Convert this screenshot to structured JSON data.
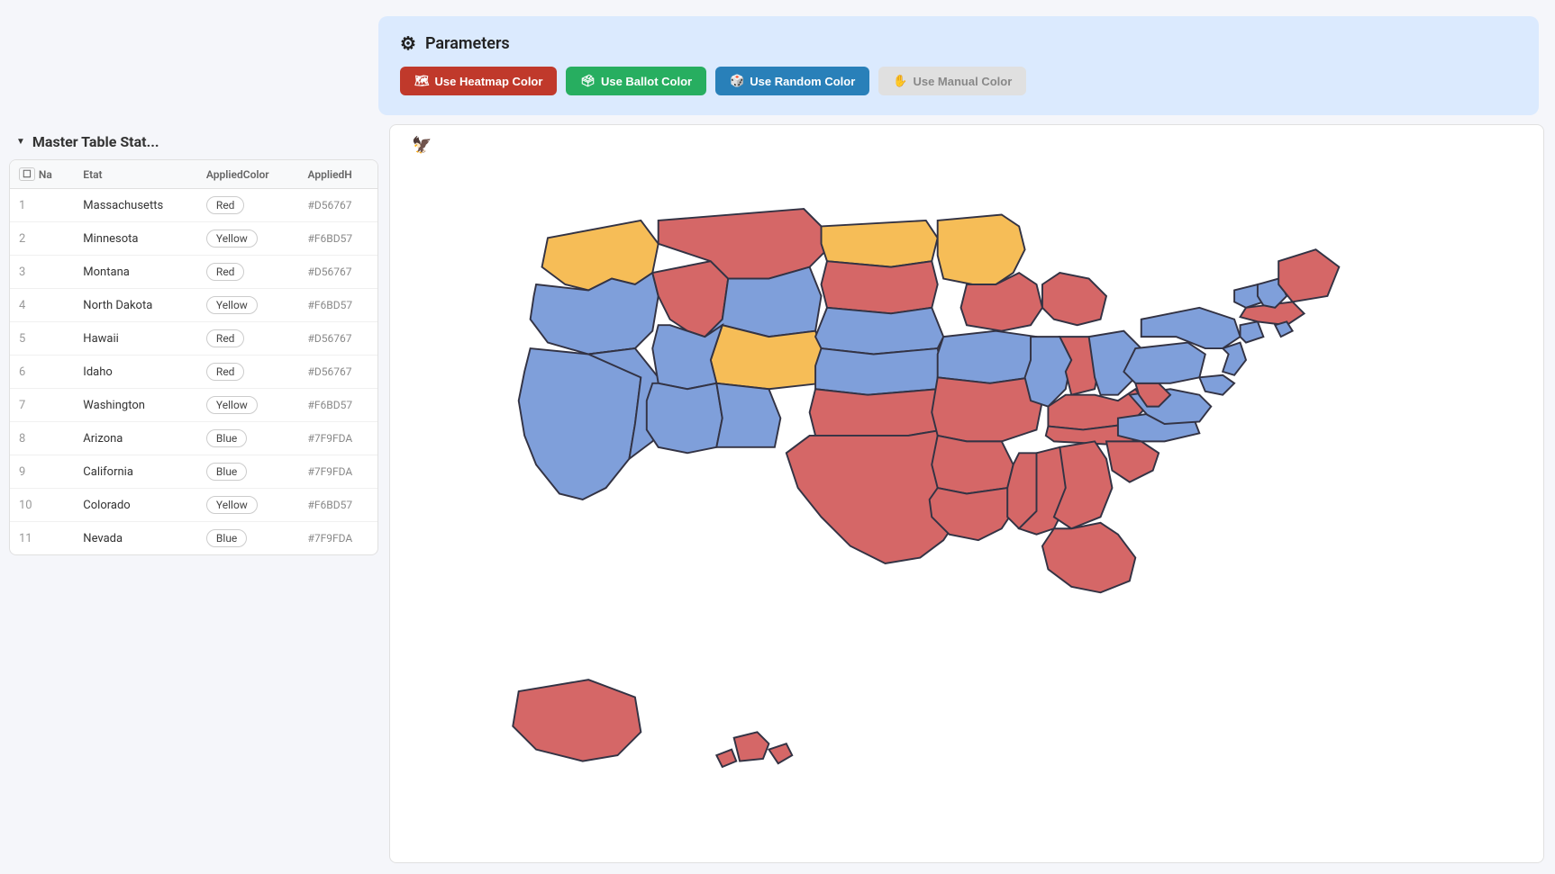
{
  "header": {
    "title": "Parameters",
    "gear_icon": "⚙"
  },
  "buttons": [
    {
      "label": "Use Heatmap Color",
      "icon": "🗺",
      "style": "btn-red",
      "name": "heatmap"
    },
    {
      "label": "Use Ballot Color",
      "icon": "🗳",
      "style": "btn-green",
      "name": "ballot"
    },
    {
      "label": "Use Random Color",
      "icon": "🎲",
      "style": "btn-blue",
      "name": "random"
    },
    {
      "label": "Use Manual Color",
      "icon": "✋",
      "style": "btn-manual",
      "name": "manual"
    }
  ],
  "section_title": "Master Table Stat...",
  "table": {
    "columns": [
      "Na",
      "Etat",
      "AppliedColor",
      "AppliedH"
    ],
    "rows": [
      {
        "num": 1,
        "state": "Massachusetts",
        "color": "Red",
        "hex": "#D56767"
      },
      {
        "num": 2,
        "state": "Minnesota",
        "color": "Yellow",
        "hex": "#F6BD57"
      },
      {
        "num": 3,
        "state": "Montana",
        "color": "Red",
        "hex": "#D56767"
      },
      {
        "num": 4,
        "state": "North Dakota",
        "color": "Yellow",
        "hex": "#F6BD57"
      },
      {
        "num": 5,
        "state": "Hawaii",
        "color": "Red",
        "hex": "#D56767"
      },
      {
        "num": 6,
        "state": "Idaho",
        "color": "Red",
        "hex": "#D56767"
      },
      {
        "num": 7,
        "state": "Washington",
        "color": "Yellow",
        "hex": "#F6BD57"
      },
      {
        "num": 8,
        "state": "Arizona",
        "color": "Blue",
        "hex": "#7F9FDA"
      },
      {
        "num": 9,
        "state": "California",
        "color": "Blue",
        "hex": "#7F9FDA"
      },
      {
        "num": 10,
        "state": "Colorado",
        "color": "Yellow",
        "hex": "#F6BD57"
      },
      {
        "num": 11,
        "state": "Nevada",
        "color": "Blue",
        "hex": "#7F9FDA"
      }
    ]
  },
  "map": {
    "bird_icon": "🦅"
  }
}
